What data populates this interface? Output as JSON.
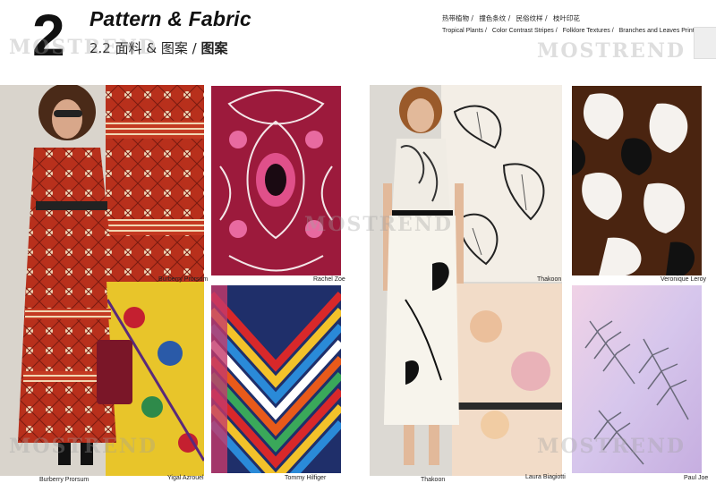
{
  "header": {
    "number": "2",
    "title": "Pattern & Fabric",
    "subtitle_prefix": "2.2 面料 & 图案 / ",
    "subtitle_bold": "图案"
  },
  "nav": {
    "cn": [
      "热带植物 /",
      "撞色条纹 /",
      "民俗纹样 /",
      "枝叶印花"
    ],
    "en": [
      "Tropical Plants /",
      "Color Contrast Stripes /",
      "Folklore Textures /",
      "Branches and Leaves Prints"
    ]
  },
  "watermark": "MOSTREND",
  "captions": {
    "burberry_prorsum_top": "Burberry Prorsum",
    "rachel_zoe": "Rachel Zoe",
    "burberry_prorsum_bottom": "Burberry Prorsum",
    "yigal_azrouel": "Yigal Azrouel",
    "tommy_hilfiger": "Tommy Hilfiger",
    "thakoon_top": "Thakoon",
    "veronique_leroy": "Veronique Leroy",
    "thakoon_bottom": "Thakoon",
    "laura_biagiotti": "Laura Biagiotti",
    "paul_joe": "Paul Joe"
  },
  "colors": {
    "folk_red": "#b8301c",
    "paisley_pink": "#b8204a",
    "brown": "#5a2a14",
    "pastel_pink": "#e7c3df"
  }
}
